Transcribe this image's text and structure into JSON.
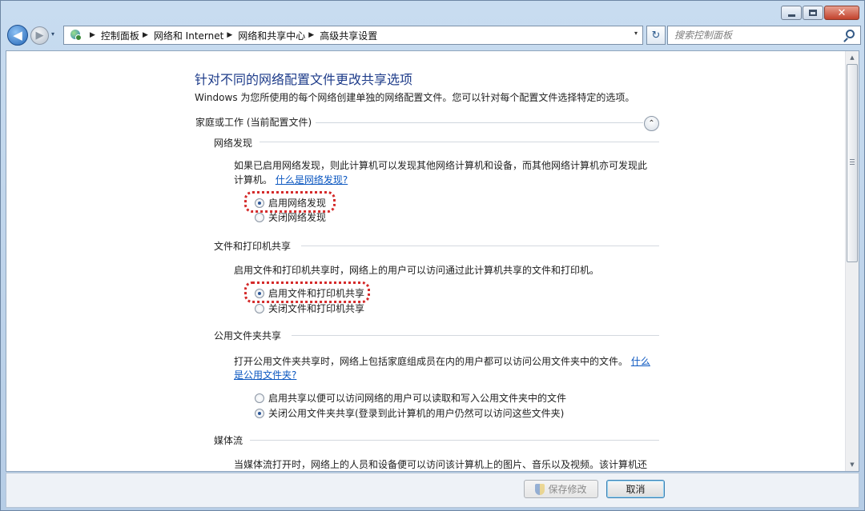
{
  "navigation": {
    "back_glyph": "◀",
    "forward_glyph": "▶",
    "history_glyph": "▾",
    "breadcrumbs": [
      "控制面板",
      "网络和 Internet",
      "网络和共享中心",
      "高级共享设置"
    ],
    "crumb_separator": "▶",
    "address_dropdown_glyph": "▾",
    "refresh_glyph": "↻",
    "search_placeholder": "搜索控制面板"
  },
  "caption": {
    "close_glyph": "✕"
  },
  "page": {
    "title": "针对不同的网络配置文件更改共享选项",
    "intro": "Windows 为您所使用的每个网络创建单独的网络配置文件。您可以针对每个配置文件选择特定的选项。",
    "profile": {
      "header": "家庭或工作 (当前配置文件)",
      "collapse_glyph": "⌃"
    },
    "sections": {
      "network_discovery": {
        "title": "网络发现",
        "desc_line1": "如果已启用网络发现，则此计算机可以发现其他网络计算机和设备，而其他网络计算机亦可发现此",
        "desc_line2": "计算机。",
        "link": "什么是网络发现?",
        "options": [
          {
            "label": "启用网络发现",
            "selected": true
          },
          {
            "label": "关闭网络发现",
            "selected": false
          }
        ]
      },
      "file_printer_sharing": {
        "title": "文件和打印机共享",
        "desc": "启用文件和打印机共享时，网络上的用户可以访问通过此计算机共享的文件和打印机。",
        "options": [
          {
            "label": "启用文件和打印机共享",
            "selected": true
          },
          {
            "label": "关闭文件和打印机共享",
            "selected": false
          }
        ]
      },
      "public_folder_sharing": {
        "title": "公用文件夹共享",
        "desc_line1": "打开公用文件夹共享时，网络上包括家庭组成员在内的用户都可以访问公用文件夹中的文件。",
        "link_part1": "什么",
        "link_part2": "是公用文件夹?",
        "options": [
          {
            "label": "启用共享以便可以访问网络的用户可以读取和写入公用文件夹中的文件",
            "selected": false
          },
          {
            "label": "关闭公用文件夹共享(登录到此计算机的用户仍然可以访问这些文件夹)",
            "selected": true
          }
        ]
      },
      "media_streaming": {
        "title": "媒体流",
        "desc": "当媒体流打开时，网络上的人员和设备便可以访问该计算机上的图片、音乐以及视频。该计算机还"
      }
    }
  },
  "scrollbar": {
    "up_glyph": "▲",
    "down_glyph": "▼"
  },
  "footer": {
    "save_label": "保存修改",
    "cancel_label": "取消"
  },
  "colors": {
    "title_blue": "#1e3c8a",
    "link_blue": "#0b57c0",
    "highlight_red": "#d42a2a"
  }
}
